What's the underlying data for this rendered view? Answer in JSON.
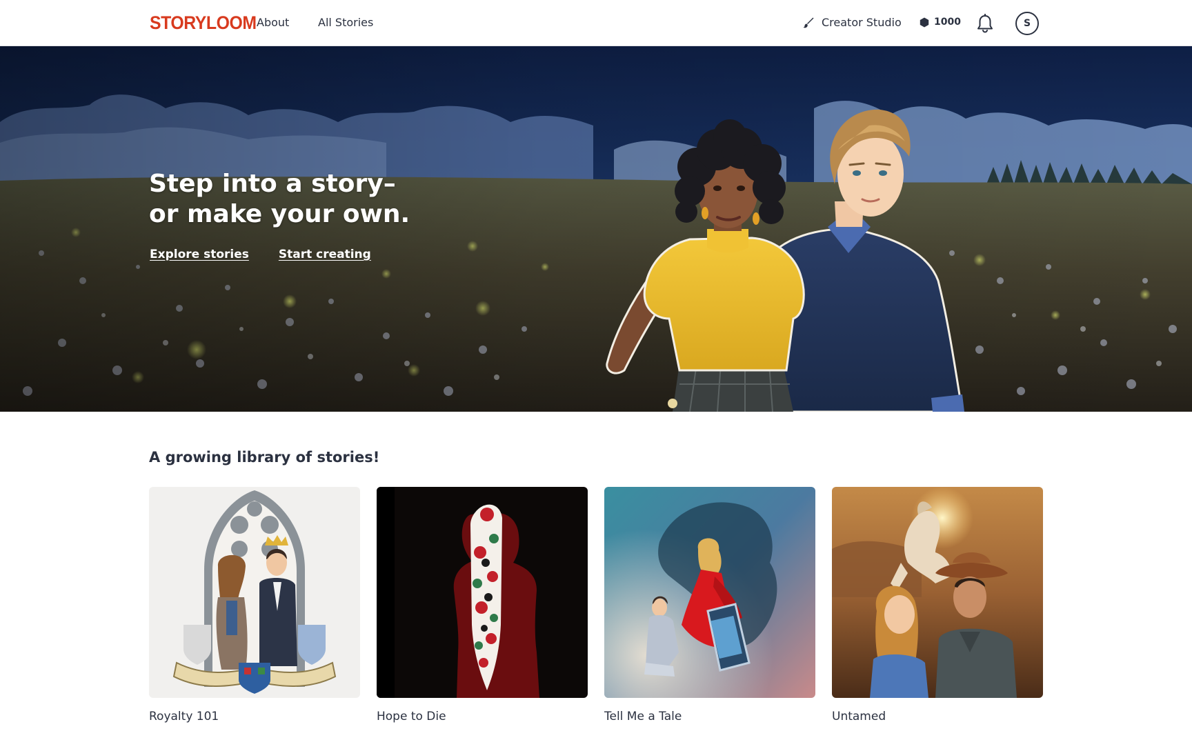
{
  "header": {
    "logo": "STORYLOOM",
    "nav": [
      {
        "label": "About"
      },
      {
        "label": "All Stories"
      }
    ],
    "creator_studio": "Creator Studio",
    "coins": "1000",
    "avatar_initial": "S"
  },
  "hero": {
    "title_line1": "Step into a story–",
    "title_line2": "or make your own.",
    "explore_label": "Explore stories",
    "create_label": "Start creating"
  },
  "library": {
    "title": "A growing library of stories!",
    "stories": [
      {
        "title": "Royalty 101"
      },
      {
        "title": "Hope to Die"
      },
      {
        "title": "Tell Me a Tale"
      },
      {
        "title": "Untamed"
      }
    ]
  },
  "colors": {
    "brand": "#d83a1e",
    "text": "#2b3140"
  }
}
